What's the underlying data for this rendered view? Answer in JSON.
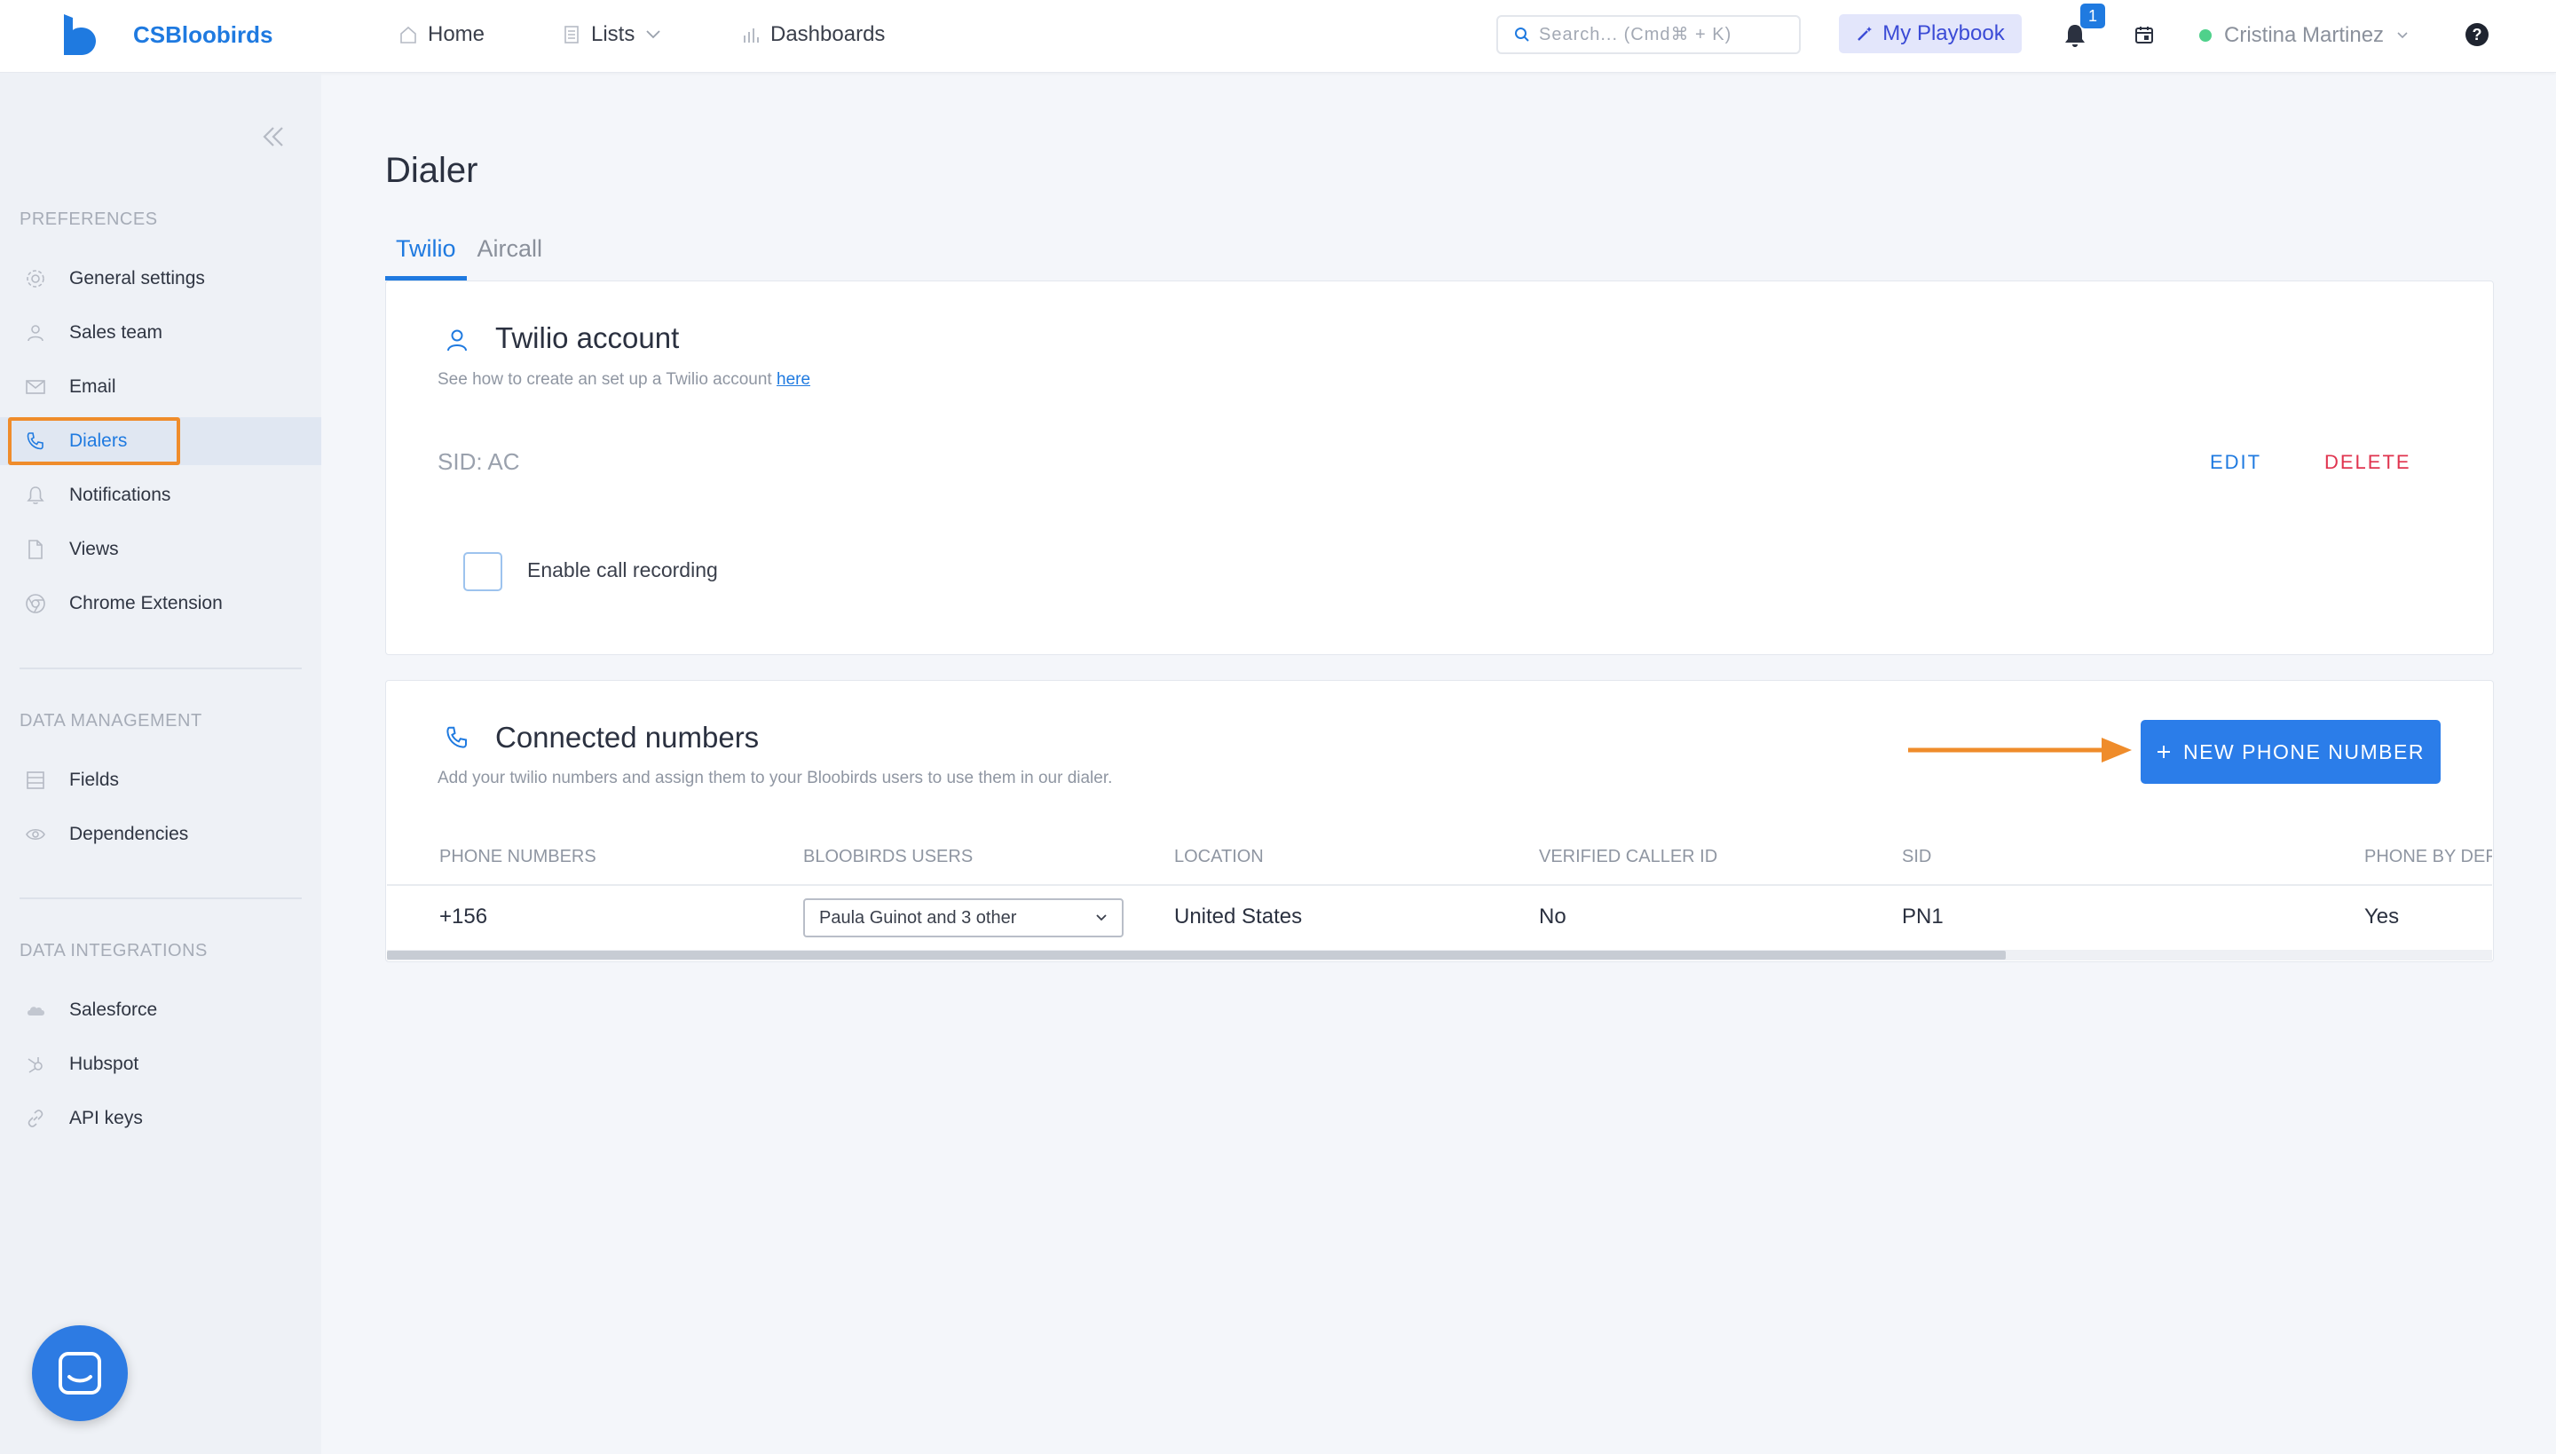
{
  "header": {
    "brand": "CSBloobirds",
    "nav": [
      {
        "label": "Home",
        "icon": "home-icon"
      },
      {
        "label": "Lists",
        "icon": "list-icon"
      },
      {
        "label": "Dashboards",
        "icon": "bar-chart-icon"
      }
    ],
    "search_placeholder": "Search... (Cmd⌘ + K)",
    "playbook_label": "My Playbook",
    "notification_count": "1",
    "user_name": "Cristina Martinez",
    "user_status_color": "#4fd18b"
  },
  "sidebar": {
    "sections": [
      {
        "heading": "PREFERENCES",
        "items": [
          {
            "label": "General settings",
            "icon": "gear-icon"
          },
          {
            "label": "Sales team",
            "icon": "user-icon"
          },
          {
            "label": "Email",
            "icon": "mail-icon"
          },
          {
            "label": "Dialers",
            "icon": "phone-icon",
            "active": true
          },
          {
            "label": "Notifications",
            "icon": "bell-icon"
          },
          {
            "label": "Views",
            "icon": "document-icon"
          },
          {
            "label": "Chrome Extension",
            "icon": "chrome-icon"
          }
        ]
      },
      {
        "heading": "DATA MANAGEMENT",
        "items": [
          {
            "label": "Fields",
            "icon": "fields-icon"
          },
          {
            "label": "Dependencies",
            "icon": "eye-icon"
          }
        ]
      },
      {
        "heading": "DATA INTEGRATIONS",
        "items": [
          {
            "label": "Salesforce",
            "icon": "cloud-icon"
          },
          {
            "label": "Hubspot",
            "icon": "hubspot-icon"
          },
          {
            "label": "API keys",
            "icon": "link-icon"
          }
        ]
      }
    ]
  },
  "main": {
    "title": "Dialer",
    "tabs": [
      "Twilio",
      "Aircall"
    ],
    "account_card": {
      "title": "Twilio account",
      "subtitle": "See how to create an set up a Twilio account",
      "subtitle_link": "here",
      "sid": "SID: AC",
      "edit_label": "EDIT",
      "delete_label": "DELETE",
      "recording_label": "Enable call recording"
    },
    "numbers_card": {
      "title": "Connected numbers",
      "subtitle": "Add your twilio numbers and assign them to your Bloobirds users to use them in our dialer.",
      "new_button_label": "NEW PHONE NUMBER",
      "columns": [
        "PHONE NUMBERS",
        "BLOOBIRDS USERS",
        "LOCATION",
        "VERIFIED CALLER ID",
        "SID",
        "PHONE BY DEF"
      ],
      "rows": [
        {
          "phone": "+156",
          "users": "Paula Guinot and 3 other",
          "location": "United States",
          "verified": "No",
          "sid": "PN1",
          "default": "Yes"
        }
      ]
    }
  },
  "colors": {
    "accent": "#1f7ae0",
    "delete": "#e0344f",
    "annotation": "#ef8c2b"
  }
}
